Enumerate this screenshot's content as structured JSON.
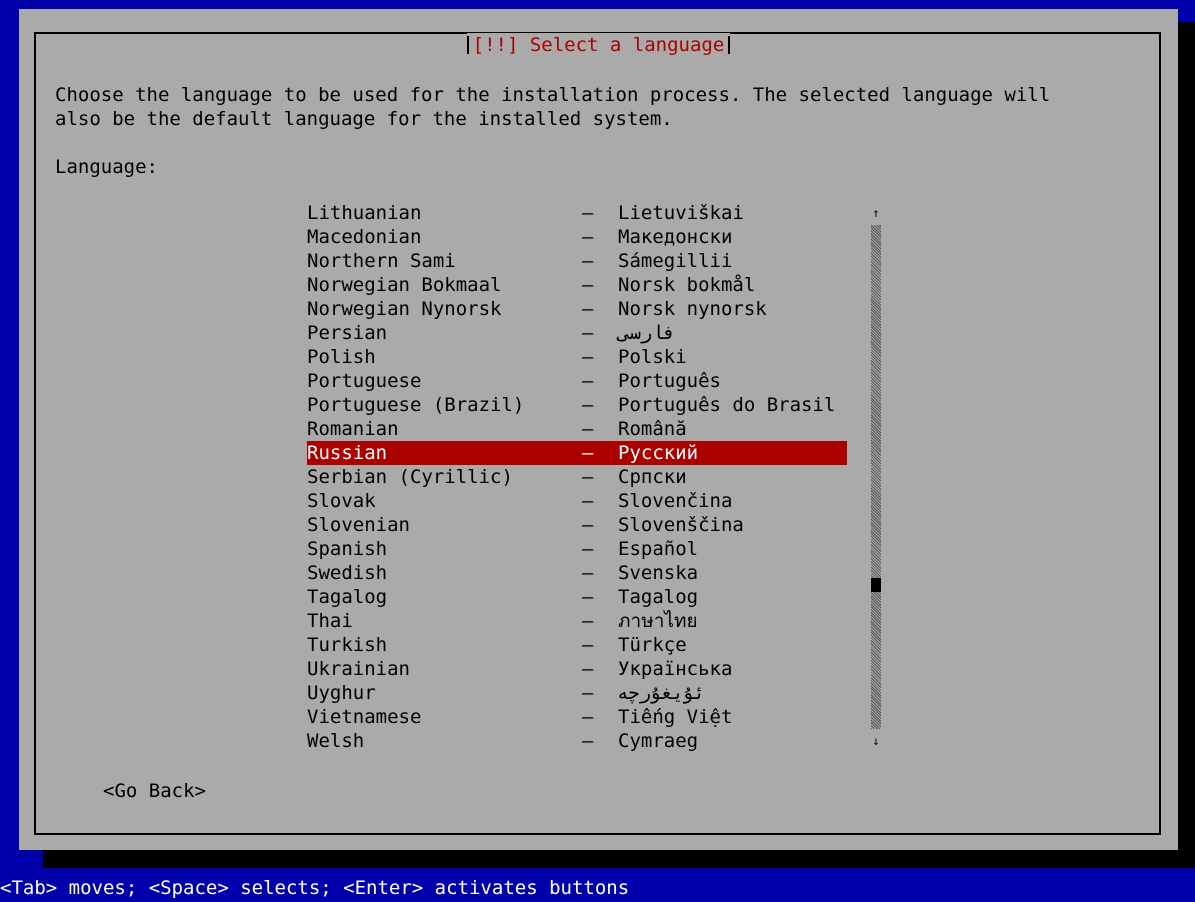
{
  "dialog": {
    "title": "[!!] Select a language",
    "description": "Choose the language to be used for the installation process. The selected language will\nalso be the default language for the installed system.",
    "list_label": "Language:",
    "selected_index": 10,
    "languages": [
      {
        "english": "Lithuanian",
        "native": "Lietuviškai"
      },
      {
        "english": "Macedonian",
        "native": "Македонски"
      },
      {
        "english": "Northern Sami",
        "native": "Sámegillii"
      },
      {
        "english": "Norwegian Bokmaal",
        "native": "Norsk bokmål"
      },
      {
        "english": "Norwegian Nynorsk",
        "native": "Norsk nynorsk"
      },
      {
        "english": "Persian",
        "native": "فارسی"
      },
      {
        "english": "Polish",
        "native": "Polski"
      },
      {
        "english": "Portuguese",
        "native": "Português"
      },
      {
        "english": "Portuguese (Brazil)",
        "native": "Português do Brasil"
      },
      {
        "english": "Romanian",
        "native": "Română"
      },
      {
        "english": "Russian",
        "native": "Русский"
      },
      {
        "english": "Serbian (Cyrillic)",
        "native": "Српски"
      },
      {
        "english": "Slovak",
        "native": "Slovenčina"
      },
      {
        "english": "Slovenian",
        "native": "Slovenščina"
      },
      {
        "english": "Spanish",
        "native": "Español"
      },
      {
        "english": "Swedish",
        "native": "Svenska"
      },
      {
        "english": "Tagalog",
        "native": "Tagalog"
      },
      {
        "english": "Thai",
        "native": "ภาษาไทย"
      },
      {
        "english": "Turkish",
        "native": "Türkçe"
      },
      {
        "english": "Ukrainian",
        "native": "Українська"
      },
      {
        "english": "Uyghur",
        "native": "ئۇيغۇرچە"
      },
      {
        "english": "Vietnamese",
        "native": "Tiếng Việt"
      },
      {
        "english": "Welsh",
        "native": "Cymraeg"
      }
    ],
    "separator": "–",
    "scrollbar": {
      "up_arrow": "↑",
      "down_arrow": "↓",
      "thumb_position": 0.72
    },
    "go_back_label": "<Go Back>"
  },
  "help_bar": "<Tab> moves; <Space> selects; <Enter> activates buttons",
  "colors": {
    "background": "#0000aa",
    "dialog": "#aaaaaa",
    "shadow": "#000000",
    "title": "#aa0000",
    "selection_bg": "#aa0000",
    "selection_fg": "#ffffff",
    "help_fg": "#ffffff"
  }
}
